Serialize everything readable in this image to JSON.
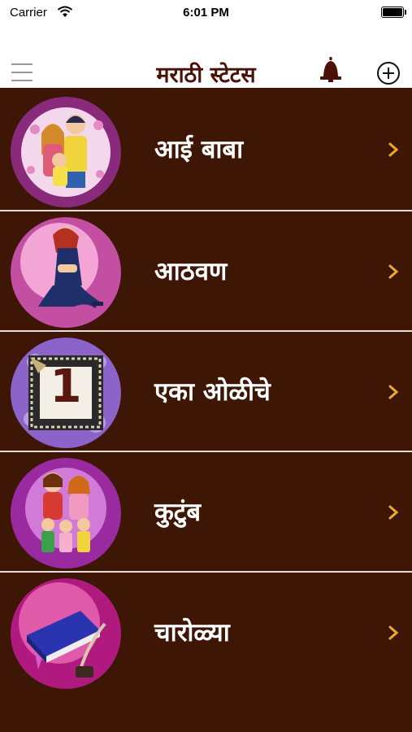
{
  "status_bar": {
    "carrier": "Carrier",
    "time": "6:01 PM"
  },
  "nav": {
    "title": "मराठी स्टेटस",
    "icons": [
      "menu-icon",
      "bell-icon",
      "add-circle-icon"
    ]
  },
  "categories": [
    {
      "label": "आई बाबा",
      "thumb": "family-couple-illustration"
    },
    {
      "label": "आठवण",
      "thumb": "sad-girl-illustration"
    },
    {
      "label": "एका ओळीचे",
      "thumb": "number-one-frame",
      "thumb_text": "1"
    },
    {
      "label": "कुटुंब",
      "thumb": "family-group-illustration"
    },
    {
      "label": "चारोळ्या",
      "thumb": "book-and-quill-illustration"
    }
  ],
  "colors": {
    "background": "#3d1606",
    "title": "#4a1206",
    "chevron": "#f0a830",
    "divider": "#e9ddd8"
  }
}
